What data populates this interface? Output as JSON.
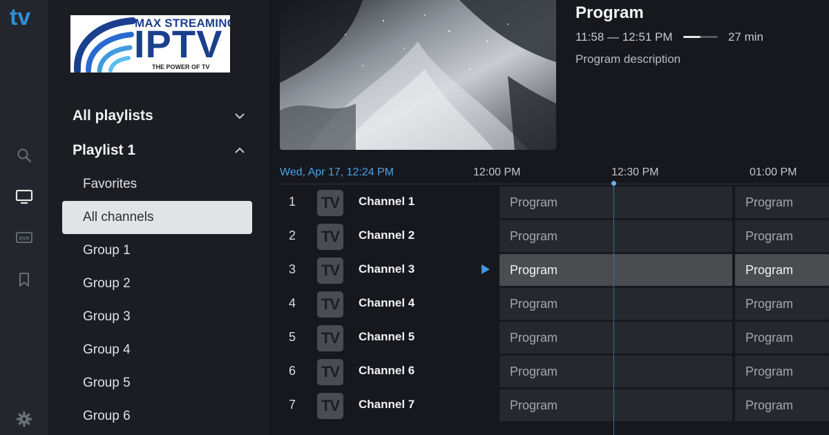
{
  "rail": {
    "logo_text": "tv",
    "icons": [
      "search-icon",
      "tv-icon",
      "dvr-icon",
      "bookmark-icon",
      "settings-icon"
    ],
    "dvr_label": "DVR"
  },
  "brand": {
    "top": "MAX STREAMING",
    "main": "IPTV",
    "tagline": "THE POWER OF TV"
  },
  "playlists": {
    "all_label": "All playlists",
    "playlist_label": "Playlist 1",
    "items": [
      "Favorites",
      "All channels",
      "Group 1",
      "Group 2",
      "Group 3",
      "Group 4",
      "Group 5",
      "Group 6"
    ],
    "active_index": 1
  },
  "program_info": {
    "title": "Program",
    "time_range": "11:58 — 12:51 PM",
    "progress": 0.5,
    "duration": "27 min",
    "description": "Program description"
  },
  "guide": {
    "date": "Wed, Apr 17, 12:24 PM",
    "ticks": [
      "12:00 PM",
      "12:30 PM",
      "01:00 PM"
    ],
    "logo_text": "TV",
    "channels": [
      {
        "num": "1",
        "name": "Channel 1",
        "programs": [
          "Program",
          "Program"
        ]
      },
      {
        "num": "2",
        "name": "Channel 2",
        "programs": [
          "Program",
          "Program"
        ]
      },
      {
        "num": "3",
        "name": "Channel 3",
        "programs": [
          "Program",
          "Program"
        ]
      },
      {
        "num": "4",
        "name": "Channel 4",
        "programs": [
          "Program",
          "Program"
        ]
      },
      {
        "num": "5",
        "name": "Channel 5",
        "programs": [
          "Program",
          "Program"
        ]
      },
      {
        "num": "6",
        "name": "Channel 6",
        "programs": [
          "Program",
          "Program"
        ]
      },
      {
        "num": "7",
        "name": "Channel 7",
        "programs": [
          "Program",
          "Program"
        ]
      }
    ],
    "selected_index": 2
  },
  "colors": {
    "accent": "#4aa3e8",
    "background": "#16181d",
    "panel": "#1b1d22"
  }
}
